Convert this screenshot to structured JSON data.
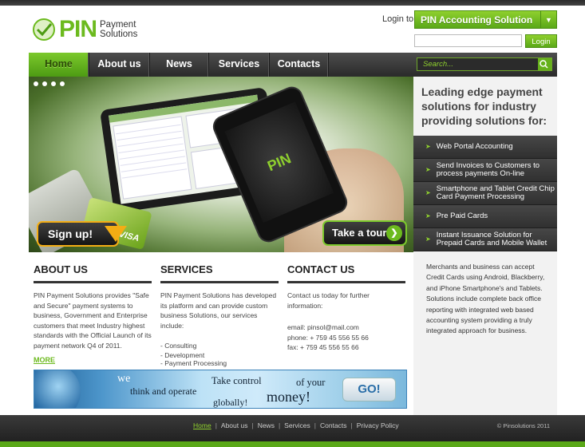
{
  "logo": {
    "mark": "PIN",
    "sub_line1": "Payment",
    "sub_line2": "Solutions"
  },
  "login": {
    "label": "Login to:",
    "selected": "PIN Accounting Solution",
    "input_value": "",
    "button": "Login"
  },
  "nav": {
    "items": [
      {
        "label": "Home"
      },
      {
        "label": "About us"
      },
      {
        "label": "News"
      },
      {
        "label": "Services"
      },
      {
        "label": "Contacts"
      }
    ],
    "search_placeholder": "Search..."
  },
  "hero": {
    "slide_count": 4,
    "phone_logo": "PIN",
    "card_brand": "VISA",
    "signup": "Sign up!",
    "tour": "Take a tour"
  },
  "right_panel": {
    "heading": "Leading edge payment solutions for industry providing solutions for:",
    "items": [
      "Web Portal Accounting",
      "Send Invoices to Customers to process payments On-line",
      "Smartphone and Tablet Credit Chip Card Payment Processing",
      "Pre Paid Cards",
      "Instant Issuance Solution for Prepaid Cards and Mobile Wallet"
    ],
    "text": "Merchants and business can accept Credit Cards using Android, Blackberry, and iPhone Smartphone's and Tablets. Solutions include complete back office reporting with integrated web based accounting system providing a truly integrated approach for business."
  },
  "about": {
    "title": "ABOUT US",
    "text": "PIN Payment Solutions provides \"Safe and Secure\" payment systems to business, Government and Enterprise customers that meet Industry highest standards with the Official Launch of its payment network Q4 of 2011.",
    "more": "MORE"
  },
  "services": {
    "title": "SERVICES",
    "text": "PIN Payment Solutions has developed its platform and can provide custom business Solutions, our services include:",
    "list": [
      "- Consulting",
      "- Development",
      "- Payment Processing"
    ]
  },
  "contact": {
    "title": "CONTACT US",
    "intro": "Contact us today for further information:",
    "email": "email: pinsol@mail.com",
    "phone": "phone: + 759 45 556 55 66",
    "fax": "fax: + 759 45 556 55 66"
  },
  "banner": {
    "we": "we",
    "think": "think and operate",
    "globally": "globally!",
    "take": "Take control",
    "of_your": "of your",
    "money": "money!",
    "go": "GO!"
  },
  "footer": {
    "links": [
      "Home",
      "About us",
      "News",
      "Services",
      "Contacts",
      "Privacy Policy"
    ],
    "copyright": "© Pinsolutions 2011"
  },
  "colors": {
    "accent": "#6cba1e",
    "dark": "#2a2a2a"
  }
}
